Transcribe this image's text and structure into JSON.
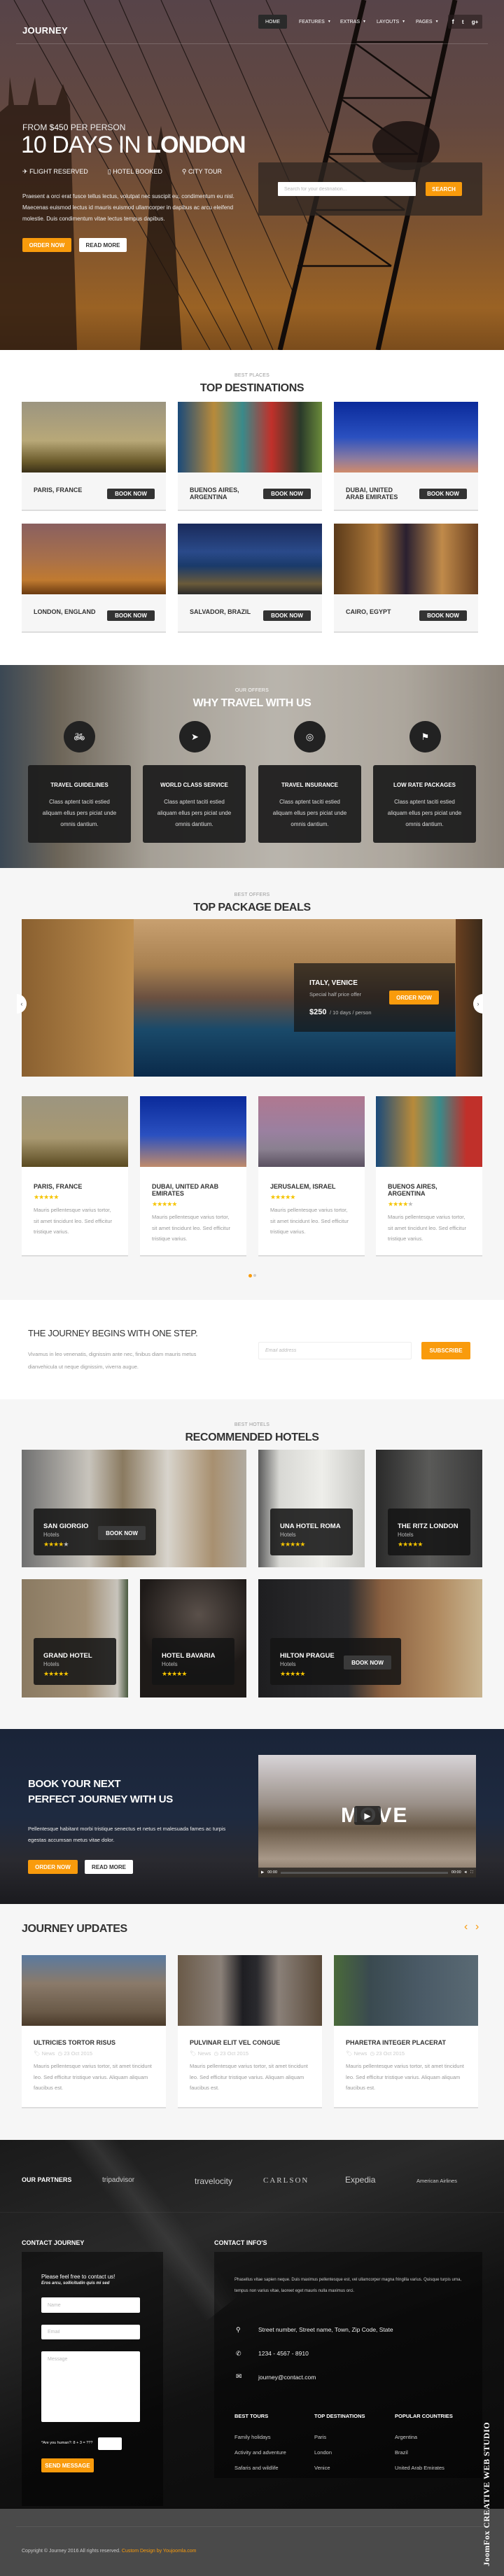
{
  "colors": {
    "accent": "#f99b0c",
    "dark": "#222222",
    "footer_bar": "#4a4a4a",
    "section_bg": "#f6f6f6"
  },
  "brand": {
    "logo": "JOURNEY"
  },
  "nav": {
    "items": [
      {
        "label": "HOME",
        "active": true
      },
      {
        "label": "FEATURES",
        "dropdown": true
      },
      {
        "label": "EXTRAS",
        "dropdown": true
      },
      {
        "label": "LAYOUTS",
        "dropdown": true
      },
      {
        "label": "PAGES",
        "dropdown": true
      }
    ],
    "social": [
      "facebook-icon",
      "twitter-icon",
      "google-plus-icon"
    ]
  },
  "hero": {
    "from_prefix": "FROM",
    "price": "$450",
    "from_suffix": "PER PERSON",
    "title_light": "10 DAYS IN",
    "title_bold": "LONDON",
    "features": [
      {
        "icon": "plane-icon",
        "label": "FLIGHT RESERVED"
      },
      {
        "icon": "hotel-icon",
        "label": "HOTEL BOOKED"
      },
      {
        "icon": "map-pin-icon",
        "label": "CITY TOUR"
      }
    ],
    "text": "Praesent a orci erat fusce tellus lectus, volutpat nec suscipit eu, condimentum eu nisl. Maecenas euismod lectus id mauris euismod ullamcorper in dapibus ac arcu eleifend molestie. Duis condimentum vitae lectus tempus dapibus.",
    "order_label": "ORDER NOW",
    "read_label": "READ MORE",
    "search_placeholder": "Search for your destination...",
    "search_label": "SEARCH"
  },
  "destinations": {
    "kicker": "BEST PLACES",
    "title": "TOP DESTINATIONS",
    "book_label": "BOOK NOW",
    "items": [
      {
        "name": "PARIS, FRANCE"
      },
      {
        "name": "BUENOS AIRES, ARGENTINA"
      },
      {
        "name": "DUBAI, UNITED ARAB EMIRATES"
      },
      {
        "name": "LONDON, ENGLAND"
      },
      {
        "name": "SALVADOR, BRAZIL"
      },
      {
        "name": "CAIRO, EGYPT"
      }
    ]
  },
  "why": {
    "kicker": "OUR OFFERS",
    "title": "WHY TRAVEL WITH US",
    "items": [
      {
        "icon": "bicycle-icon",
        "title": "TRAVEL GUIDELINES",
        "text": "Class aptent taciti estied aliquam ellus pers piciat unde omnis dantium."
      },
      {
        "icon": "paper-plane-icon",
        "title": "WORLD CLASS SERVICE",
        "text": "Class aptent taciti estied aliquam ellus pers piciat unde omnis dantium."
      },
      {
        "icon": "life-ring-icon",
        "title": "TRAVEL INSURANCE",
        "text": "Class aptent taciti estied aliquam ellus pers piciat unde omnis dantium."
      },
      {
        "icon": "flag-icon",
        "title": "LOW RATE PACKAGES",
        "text": "Class aptent taciti estied aliquam ellus pers piciat unde omnis dantium."
      }
    ]
  },
  "packages": {
    "kicker": "BEST OFFERS",
    "title": "TOP PACKAGE DEALS",
    "slide": {
      "name": "ITALY, VENICE",
      "subtitle": "Special half price offer",
      "price": "$250",
      "price_suffix": "/ 10 days / person",
      "order_label": "ORDER NOW"
    },
    "cards": [
      {
        "name": "PARIS, FRANCE",
        "rating": 5,
        "text": "Mauris pellentesque varius tortor, sit amet tincidunt leo. Sed efficitur tristique varius."
      },
      {
        "name": "DUBAI, UNITED ARAB EMIRATES",
        "rating": 5,
        "text": "Mauris pellentesque varius tortor, sit amet tincidunt leo. Sed efficitur tristique varius."
      },
      {
        "name": "JERUSALEM, ISRAEL",
        "rating": 5,
        "text": "Mauris pellentesque varius tortor, sit amet tincidunt leo. Sed efficitur tristique varius."
      },
      {
        "name": "BUENOS AIRES, ARGENTINA",
        "rating": 4,
        "text": "Mauris pellentesque varius tortor, sit amet tincidunt leo. Sed efficitur tristique varius."
      }
    ],
    "pages": 2,
    "active_page": 1
  },
  "newsletter": {
    "title": "THE JOURNEY BEGINS WITH ONE STEP.",
    "text": "Vivamus in leo venenatis, dignissim ante nec, finibus diam mauris metus dianvehicula ut neque dignissim, viverra augue.",
    "placeholder": "Email address",
    "button": "SUBSCRIBE"
  },
  "hotels": {
    "kicker": "BEST HOTELS",
    "title": "RECOMMENDED HOTELS",
    "book_label": "BOOK NOW",
    "items": [
      {
        "name": "SAN GIORGIO",
        "category": "Hotels",
        "rating": 4
      },
      {
        "name": "UNA HOTEL ROMA",
        "category": "Hotels",
        "rating": 5
      },
      {
        "name": "THE RITZ LONDON",
        "category": "Hotels",
        "rating": 5
      },
      {
        "name": "GRAND HOTEL",
        "category": "Hotels",
        "rating": 5
      },
      {
        "name": "HOTEL BAVARIA",
        "category": "Hotels",
        "rating": 5
      },
      {
        "name": "HILTON PRAGUE",
        "category": "Hotels",
        "rating": 5
      }
    ]
  },
  "booking": {
    "title_line1": "BOOK YOUR NEXT",
    "title_line2": "PERFECT JOURNEY WITH US",
    "text": "Pellentesque habitant morbi tristique senectus et netus et malesuada fames ac turpis egestas accumsan metus vitae dolor.",
    "order_label": "ORDER NOW",
    "read_label": "READ MORE",
    "video": {
      "overlay_text": "MOVE",
      "time_current": "00:00",
      "time_total": "00:00"
    }
  },
  "updates": {
    "title": "JOURNEY UPDATES",
    "items": [
      {
        "title": "ULTRICIES TORTOR RISUS",
        "category": "News",
        "date": "23 Oct 2015",
        "text": "Mauris pellentesque varius tortor, sit amet tincidunt leo. Sed efficitur tristique varius. Aliquam aliquam faucibus est."
      },
      {
        "title": "PULVINAR ELIT VEL CONGUE",
        "category": "News",
        "date": "23 Oct 2015",
        "text": "Mauris pellentesque varius tortor, sit amet tincidunt leo. Sed efficitur tristique varius. Aliquam aliquam faucibus est."
      },
      {
        "title": "PHARETRA INTEGER PLACERAT",
        "category": "News",
        "date": "23 Oct 2015",
        "text": "Mauris pellentesque varius tortor, sit amet tincidunt leo. Sed efficitur tristique varius. Aliquam aliquam faucibus est."
      }
    ]
  },
  "partners": {
    "title": "OUR PARTNERS",
    "logos": [
      "tripadvisor",
      "travelocity",
      "CARLSON",
      "Expedia",
      "American Airlines"
    ]
  },
  "contact_form": {
    "title": "CONTACT JOURNEY",
    "intro": "Please feel free to contact us!",
    "sub": "Eros arcu, sollicitudin quis mi sed",
    "name_placeholder": "Name",
    "email_placeholder": "Email",
    "message_placeholder": "Message",
    "captcha_label": "*Are you human?: 8 + 3 = ???",
    "send_label": "SEND MESSAGE"
  },
  "contact_info": {
    "title": "CONTACT INFO'S",
    "text": "Phasellus vitae sapien neque. Duis maximus pellentesque est, vel ullamcorper magna fringilla varius. Quisque turpis urna, tempus non varius vitae, laoreet eget mauris nulla maximus orci.",
    "address": "Street number, Street name, Town, Zip Code, State",
    "phone": "1234 - 4567 - 8910",
    "email": "journey@contact.com",
    "columns": [
      {
        "title": "BEST TOURS",
        "links": [
          "Family holidays",
          "Activity and adventure",
          "Safaris and wildlife"
        ]
      },
      {
        "title": "TOP DESTINATIONS",
        "links": [
          "Paris",
          "London",
          "Venice"
        ]
      },
      {
        "title": "POPULAR COUNTRIES",
        "links": [
          "Argentina",
          "Brazil",
          "United Arab Emirates"
        ]
      }
    ]
  },
  "footer": {
    "copyright": "Copyright © Journey 2016 All rights reserved.",
    "credit": "Custom Design by Youjoomla.com",
    "badge": "JoomFox CREATIVE WEB STUDIO"
  }
}
